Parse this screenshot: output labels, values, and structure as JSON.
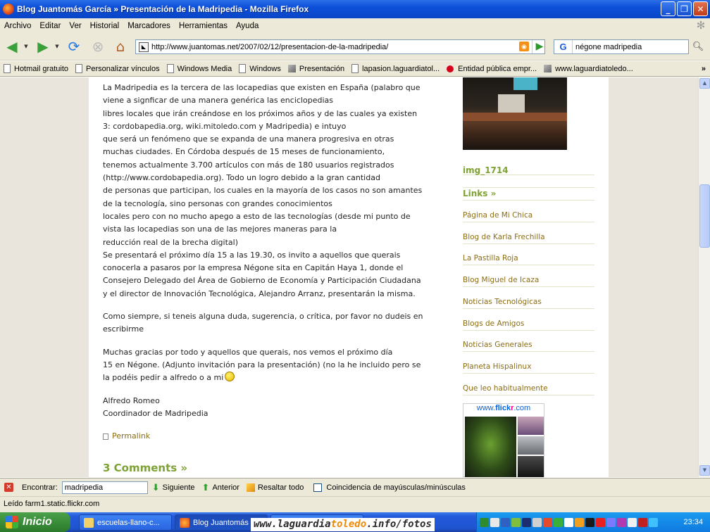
{
  "window": {
    "title": "Blog Juantomás García » Presentación de la Madripedia - Mozilla Firefox",
    "buttons": {
      "minimize": "_",
      "maximize": "❐",
      "close": "✕"
    }
  },
  "menu": [
    "Archivo",
    "Editar",
    "Ver",
    "Historial",
    "Marcadores",
    "Herramientas",
    "Ayuda"
  ],
  "nav": {
    "url": "http://www.juantomas.net/2007/02/12/presentacion-de-la-madripedia/",
    "search_engine": "G",
    "search_value": "négone madripedia"
  },
  "bookmarks": [
    {
      "label": "Hotmail gratuito",
      "icon": "page-icon"
    },
    {
      "label": "Personalizar vínculos",
      "icon": "page-icon"
    },
    {
      "label": "Windows Media",
      "icon": "page-icon"
    },
    {
      "label": "Windows",
      "icon": "page-icon"
    },
    {
      "label": "Presentación",
      "icon": "image-icon"
    },
    {
      "label": "lapasion.laguardiatol...",
      "icon": "page-icon"
    },
    {
      "label": "Entidad pública empr...",
      "icon": "red-dot-icon"
    },
    {
      "label": "www.laguardiatoledo...",
      "icon": "image-icon"
    }
  ],
  "bookmarks_more": "»",
  "post": {
    "lines": [
      "La Madripedia es la tercera de las locapedias que existen en España (palabro que",
      "viene a signficar de una manera genérica las enciclopedias",
      "libres locales que irán creándose en los próximos años y de las cuales ya existen",
      "3: cordobapedia.org, wiki.mitoledo.com y Madripedia) e intuyo",
      "que será un fenómeno que se expanda de una manera progresiva en otras",
      "muchas ciudades. En Córdoba después de 15 meses de funcionamiento,",
      "tenemos actualmente 3.700 artículos con más de 180 usuarios registrados",
      "(http://www.cordobapedia.org).  Todo un logro debido a la gran cantidad",
      "de personas que participan, los cuales en la mayoría de los casos no son amantes",
      "de la tecnología, sino personas con grandes conocimientos",
      "locales pero con no mucho apego a esto de las tecnologías (desde mi punto de",
      "vista las locapedias son una de las mejores maneras para la",
      "reducción real de la brecha digital)",
      "Se presentará el próximo día 15 a las 19.30, os invito a aquellos que querais",
      "conocerla a pasaros por la empresa Négone sita en Capitán Haya 1, donde el",
      "Consejero Delegado del Área de Gobierno de Economía y Participación Ciudadana",
      "y el director de Innovación Tecnológica, Alejandro Arranz, presentarán la misma."
    ],
    "para2": [
      "Como siempre, si teneis alguna duda, sugerencia, o crítica, por favor no dudeis en",
      "escribirme"
    ],
    "para3": [
      "Muchas gracias por todo y aquellos que querais, nos vemos el próximo día",
      "15 en Négone. (Adjunto invitación para la presentación) (no la he incluido pero se",
      "la podéis pedir a alfredo o a mi"
    ],
    "signature": [
      "Alfredo Romeo",
      "Coordinador de Madripedia"
    ],
    "permalink": "Permalink",
    "comments": "3 Comments »"
  },
  "sidebar": {
    "photo_caption": "img_1714",
    "links_title": "Links »",
    "links": [
      "Página de Mi Chica",
      "Blog de Karla Frechilla",
      "La Pastilla Roja",
      "Blog Miguel de Icaza",
      "Noticias Tecnológicas",
      "Blogs de Amigos",
      "Noticias Generales",
      "Planeta Hispalinux",
      "Que leo habitualmente"
    ],
    "flickr": {
      "www": "www.",
      "flick": "flick",
      "r": "r",
      "com": ".com"
    }
  },
  "findbar": {
    "label": "Encontrar:",
    "value": "madripedia",
    "next": "Siguiente",
    "prev": "Anterior",
    "highlight": "Resaltar todo",
    "match_case": "Coincidencia de mayúsculas/minúsculas"
  },
  "status": "Leído farm1.static.flickr.com",
  "taskbar": {
    "start": "Inicio",
    "tasks": [
      "escuelas-llano-c...",
      "Blog Juantomás"
    ],
    "clock": "23:34"
  },
  "watermark": {
    "a": "www.laguardia",
    "b": "toledo",
    "c": ".info/fotos"
  },
  "colors": {
    "accent_green": "#7ea233",
    "link_brown": "#8b6d14",
    "titlebar_blue": "#0c4fd8"
  }
}
